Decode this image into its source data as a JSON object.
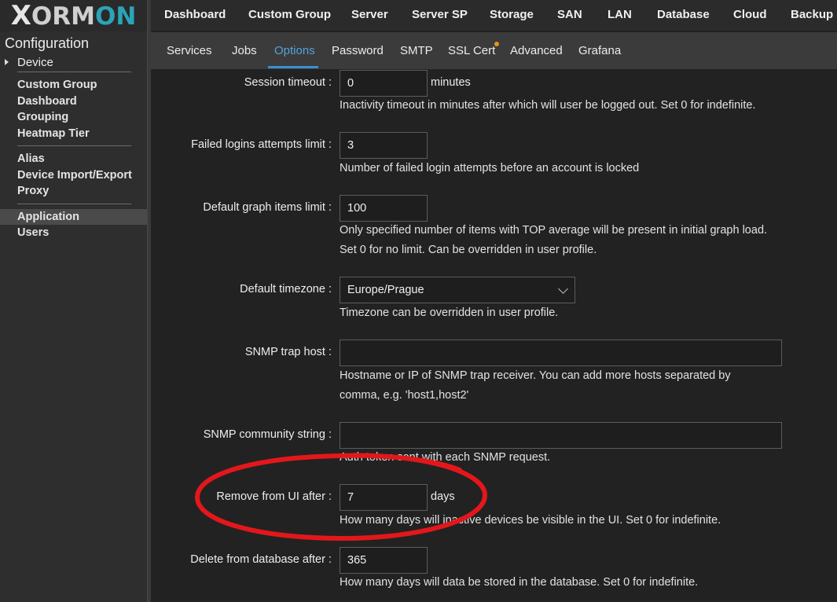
{
  "logo": {
    "x": "X",
    "mid": "ORM",
    "end": "ON"
  },
  "sidebar": {
    "title": "Configuration",
    "device": "Device",
    "groups": [
      [
        "Custom Group",
        "Dashboard",
        "Grouping",
        "Heatmap Tier"
      ],
      [
        "Alias",
        "Device Import/Export",
        "Proxy"
      ],
      [
        "Application",
        "Users"
      ]
    ],
    "active": "Application"
  },
  "topmenu": [
    "Dashboard",
    "Custom Group",
    "Server",
    "Server SP",
    "Storage",
    "SAN",
    "LAN",
    "Database",
    "Cloud",
    "Backup"
  ],
  "subtabs": [
    "Services",
    "Jobs",
    "Options",
    "Password",
    "SMTP",
    "SSL Cert",
    "Advanced",
    "Grafana"
  ],
  "active_subtab": "Options",
  "colors": {
    "accent": "#52a3dc",
    "notification": "#e8941a",
    "annotation": "#e3171b"
  },
  "form": {
    "session_timeout": {
      "label": "Session timeout",
      "value": "0",
      "unit": "minutes",
      "help": [
        "Inactivity timeout in minutes after which will user be logged out. Set 0 for indefinite."
      ]
    },
    "failed_logins": {
      "label": "Failed logins attempts limit",
      "value": "3",
      "help": [
        "Number of failed login attempts before an account is locked"
      ]
    },
    "graph_items": {
      "label": "Default graph items limit",
      "value": "100",
      "help": [
        "Only specified number of items with TOP average will be present in initial graph load.",
        "Set 0 for no limit. Can be overridden in user profile."
      ]
    },
    "timezone": {
      "label": "Default timezone",
      "value": "Europe/Prague",
      "help": [
        "Timezone can be overridden in user profile."
      ]
    },
    "snmp_host": {
      "label": "SNMP trap host",
      "value": "",
      "help": [
        "Hostname or IP of SNMP trap receiver. You can add more hosts separated by",
        "comma, e.g. 'host1,host2'"
      ]
    },
    "snmp_community": {
      "label": "SNMP community string",
      "value": "",
      "help": [
        "Auth token sent with each SNMP request."
      ]
    },
    "remove_ui": {
      "label": "Remove from UI after",
      "value": "7",
      "unit": "days",
      "help": [
        "How many days will inactive devices be visible in the UI. Set 0 for indefinite."
      ]
    },
    "delete_db": {
      "label": "Delete from database after",
      "value": "365",
      "help": [
        "How many days will data be stored in the database. Set 0 for indefinite."
      ]
    }
  }
}
